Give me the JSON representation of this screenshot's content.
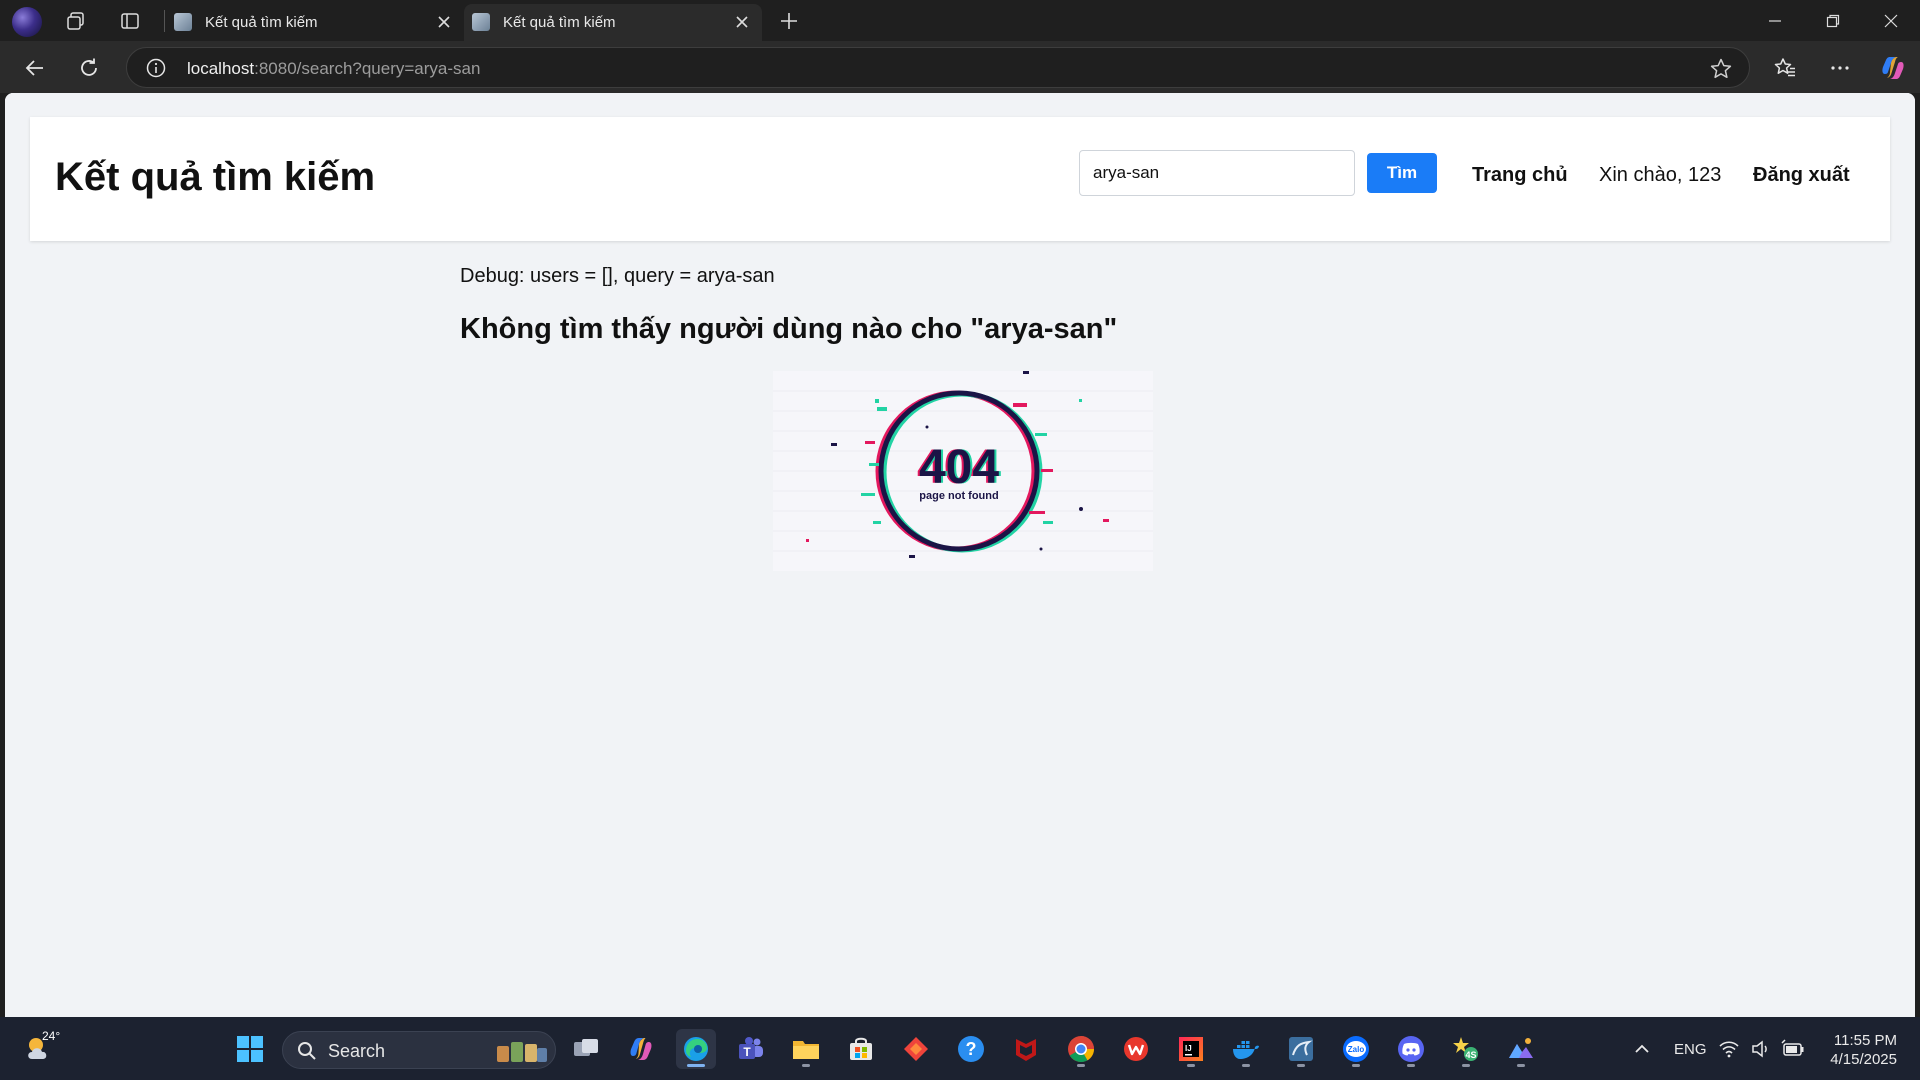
{
  "browser": {
    "tabs": [
      {
        "title": "Kết quả tìm kiếm",
        "active": false
      },
      {
        "title": "Kết quả tìm kiếm",
        "active": true
      }
    ],
    "url_host": "localhost",
    "url_rest": ":8080/search?query=arya-san"
  },
  "page": {
    "title": "Kết quả tìm kiếm",
    "search_value": "arya-san",
    "search_button": "Tìm",
    "nav": {
      "home": "Trang chủ",
      "greeting": "Xin chào, 123",
      "logout": "Đăng xuất"
    },
    "debug_text": "Debug: users = [], query = arya-san",
    "no_result": "Không tìm thấy người dùng nào cho \"arya-san\"",
    "image": {
      "code": "404",
      "caption": "page not found"
    }
  },
  "taskbar": {
    "weather_temp": "24°",
    "search_label": "Search",
    "language": "ENG",
    "time": "11:55 PM",
    "date": "4/15/2025"
  },
  "colors": {
    "accent": "#1a7cf7",
    "page_bg": "#f1f3f6",
    "chrome_bg": "#1f1f1f",
    "taskbar_bg": "#1c2230"
  }
}
